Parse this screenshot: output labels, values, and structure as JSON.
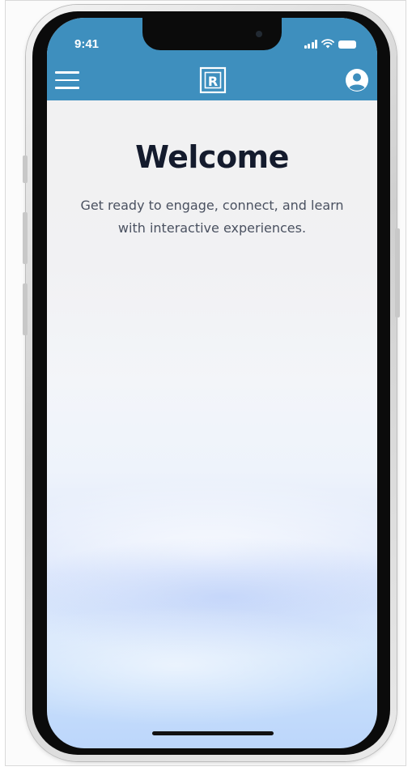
{
  "status_bar": {
    "time": "9:41",
    "icons": [
      "cellular-signal-icon",
      "wifi-icon",
      "battery-icon"
    ]
  },
  "app_bar": {
    "background_color": "#3e8fbe",
    "menu_icon": "hamburger-menu-icon",
    "logo_letter": "R",
    "profile_icon": "user-account-icon"
  },
  "main": {
    "title": "Welcome",
    "subtitle_line1": "Get ready to engage, connect, and learn",
    "subtitle_line2": "with interactive experiences."
  },
  "colors": {
    "title": "#141b2d",
    "subtitle": "#4a5160",
    "gradient_bottom": "#bcd6fb"
  }
}
